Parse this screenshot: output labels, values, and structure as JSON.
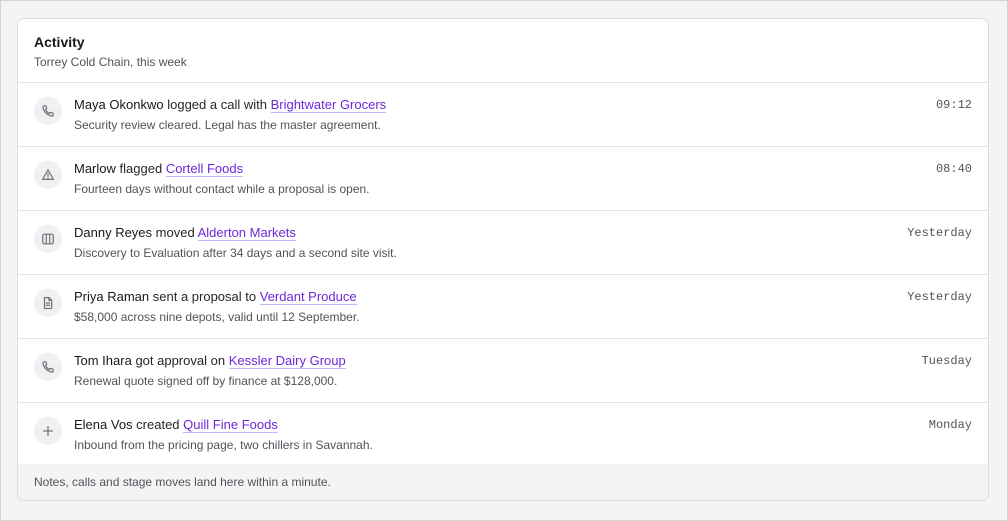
{
  "header": {
    "title": "Activity",
    "subtitle": "Torrey Cold Chain, this week"
  },
  "activities": [
    {
      "icon": "phone-icon",
      "actor": "Maya Okonkwo",
      "verb": "logged a call with",
      "company": "Brightwater Grocers",
      "detail": "Security review cleared. Legal has the master agreement.",
      "time": "09:12"
    },
    {
      "icon": "warning-icon",
      "actor": "Marlow",
      "verb": "flagged",
      "company": "Cortell Foods",
      "detail": "Fourteen days without contact while a proposal is open.",
      "time": "08:40"
    },
    {
      "icon": "kanban-columns-icon",
      "actor": "Danny Reyes",
      "verb": "moved",
      "company": "Alderton Markets",
      "detail": "Discovery to Evaluation after 34 days and a second site visit.",
      "time": "Yesterday"
    },
    {
      "icon": "document-icon",
      "actor": "Priya Raman",
      "verb": "sent a proposal to",
      "company": "Verdant Produce",
      "detail": "$58,000 across nine depots, valid until 12 September.",
      "time": "Yesterday"
    },
    {
      "icon": "phone-icon",
      "actor": "Tom Ihara",
      "verb": "got approval on",
      "company": "Kessler Dairy Group",
      "detail": "Renewal quote signed off by finance at $128,000.",
      "time": "Tuesday"
    },
    {
      "icon": "plus-icon",
      "actor": "Elena Vos",
      "verb": "created",
      "company": "Quill Fine Foods",
      "detail": "Inbound from the pricing page, two chillers in Savannah.",
      "time": "Monday"
    }
  ],
  "footer": {
    "note": "Notes, calls and stage moves land here within a minute."
  },
  "colors": {
    "accent_link": "#6d28d9",
    "muted_text": "#52525b",
    "icon_bg": "#f0f0f2"
  }
}
